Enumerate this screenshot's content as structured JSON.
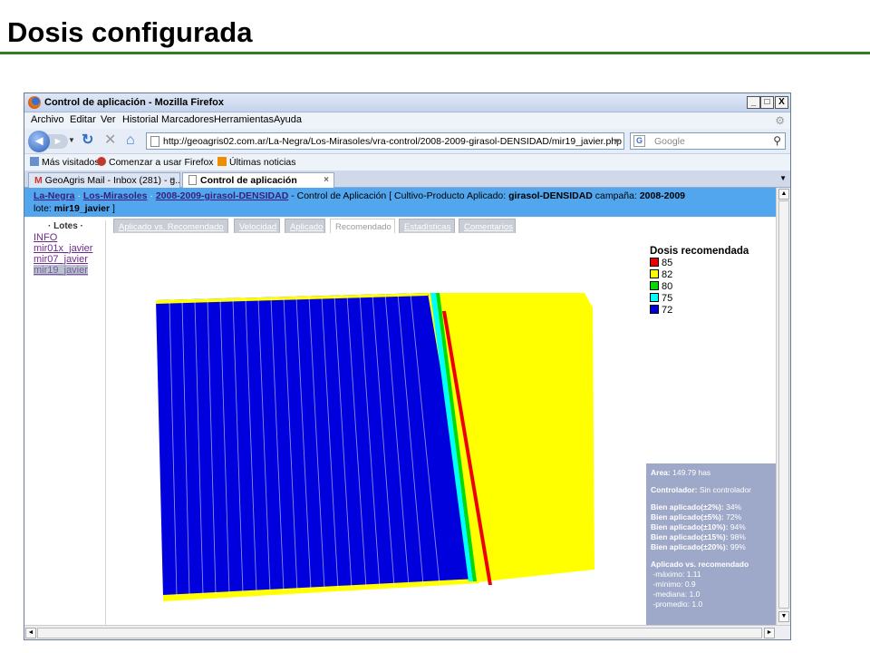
{
  "slide": {
    "title": "Dosis configurada"
  },
  "window": {
    "title": "Control de aplicación - Mozilla Firefox",
    "min": "_",
    "max": "□",
    "close": "X"
  },
  "menu": [
    "Archivo",
    "Editar",
    "Ver",
    "Historial",
    "Marcadores",
    "Herramientas",
    "Ayuda"
  ],
  "nav": {
    "url": "http://geoagris02.com.ar/La-Negra/Los-Mirasoles/vra-control/2008-2009-girasol-DENSIDAD/mir19_javier.php",
    "search_placeholder": "Google",
    "search_engine_letter": "G"
  },
  "bookmarks": [
    "Más visitados",
    "Comenzar a usar Firefox",
    "Últimas noticias"
  ],
  "browser_tabs": [
    {
      "label": "GeoAgris Mail - Inbox (281) - g...",
      "active": false
    },
    {
      "label": "Control de aplicación",
      "active": true
    }
  ],
  "breadcrumb": {
    "link1": "La-Negra",
    "link2": "Los-Mirasoles",
    "link3": "2008-2009-girasol-DENSIDAD",
    "sep": "·",
    "middle": " - Control de Aplicación [ Cultivo-Producto Aplicado: ",
    "product": "girasol-DENSIDAD",
    "campaign_label": " campaña: ",
    "campaign": "2008-2009",
    "lote_label": "lote: ",
    "lote": "mir19_javier",
    "end": " ]"
  },
  "sidebar": {
    "title": "· Lotes ·",
    "items": [
      "INFO",
      "mir01x_javier",
      "mir07_javier",
      "mir19_javier"
    ],
    "selected_index": 3
  },
  "page_tabs": [
    {
      "label": "Aplicado vs. Recomendado",
      "active": false
    },
    {
      "label": "Velocidad",
      "active": false
    },
    {
      "label": "Aplicado",
      "active": false
    },
    {
      "label": "Recomendado",
      "active": true
    },
    {
      "label": "Estadísticas",
      "active": false
    },
    {
      "label": "Comentarios",
      "active": false
    }
  ],
  "legend": {
    "title": "Dosis recomendada",
    "items": [
      {
        "label": "85",
        "color": "#ee0000"
      },
      {
        "label": "82",
        "color": "#ffff00"
      },
      {
        "label": "80",
        "color": "#00dd00"
      },
      {
        "label": "75",
        "color": "#00ffff"
      },
      {
        "label": "72",
        "color": "#0000dd"
      }
    ]
  },
  "stats": {
    "area_label": "Area:",
    "area_value": "149.79 has",
    "controller_label": "Controlador:",
    "controller_value": "Sin controlador",
    "bien": [
      {
        "label": "Bien aplicado(±2%):",
        "value": "34%"
      },
      {
        "label": "Bien aplicado(±5%):",
        "value": "72%"
      },
      {
        "label": "Bien aplicado(±10%):",
        "value": "94%"
      },
      {
        "label": "Bien aplicado(±15%):",
        "value": "98%"
      },
      {
        "label": "Bien aplicado(±20%):",
        "value": "99%"
      }
    ],
    "ratio_title": "Aplicado vs. recomendado",
    "ratio": [
      {
        "label": "-máximo:",
        "value": "1.11"
      },
      {
        "label": "-mínimo:",
        "value": "0.9"
      },
      {
        "label": "-mediana:",
        "value": "1.0"
      },
      {
        "label": "-promedio:",
        "value": "1.0"
      }
    ]
  },
  "colors": {
    "accent_rule": "#2e7d1f",
    "breadcrumb_bg": "#51a6ee",
    "stats_bg": "#9ea8c8",
    "zone_72": "#0000dd",
    "zone_75": "#00ffff",
    "zone_80": "#00dd00",
    "zone_82": "#ffff00",
    "zone_85": "#ee0000"
  }
}
